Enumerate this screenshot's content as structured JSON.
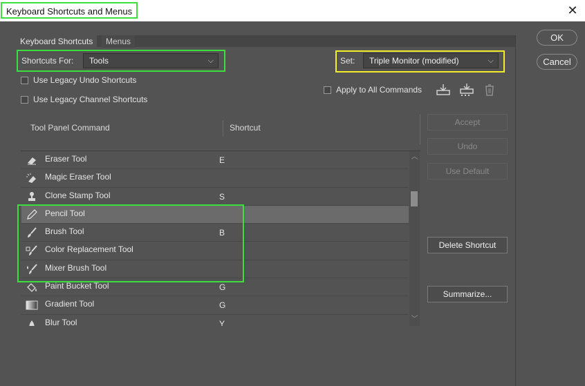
{
  "window": {
    "title": "Keyboard Shortcuts and Menus"
  },
  "tabs": [
    {
      "label": "Keyboard Shortcuts"
    },
    {
      "label": "Menus"
    }
  ],
  "shortcuts_for": {
    "label": "Shortcuts For:",
    "value": "Tools"
  },
  "set": {
    "label": "Set:",
    "value": "Triple Monitor (modified)"
  },
  "checkboxes": {
    "legacy_undo": {
      "label": "Use Legacy Undo Shortcuts",
      "checked": false
    },
    "legacy_channel": {
      "label": "Use Legacy Channel Shortcuts",
      "checked": false
    },
    "apply_all": {
      "label": "Apply to All Commands",
      "checked": false
    }
  },
  "columns": {
    "command": "Tool Panel Command",
    "shortcut": "Shortcut"
  },
  "rows": [
    {
      "icon": "eraser-icon",
      "name": "Eraser Tool",
      "shortcut": "E"
    },
    {
      "icon": "magic-eraser-icon",
      "name": "Magic Eraser Tool",
      "shortcut": ""
    },
    {
      "icon": "clone-stamp-icon",
      "name": "Clone Stamp Tool",
      "shortcut": "S"
    },
    {
      "icon": "pencil-icon",
      "name": "Pencil Tool",
      "shortcut": "",
      "selected": true
    },
    {
      "icon": "brush-icon",
      "name": "Brush Tool",
      "shortcut": "B"
    },
    {
      "icon": "color-replacement-icon",
      "name": "Color Replacement Tool",
      "shortcut": ""
    },
    {
      "icon": "mixer-brush-icon",
      "name": "Mixer Brush Tool",
      "shortcut": ""
    },
    {
      "icon": "paint-bucket-icon",
      "name": "Paint Bucket Tool",
      "shortcut": "G"
    },
    {
      "icon": "gradient-icon",
      "name": "Gradient Tool",
      "shortcut": "G"
    },
    {
      "icon": "blur-icon",
      "name": "Blur Tool",
      "shortcut": "Y"
    }
  ],
  "side_buttons": {
    "accept": "Accept",
    "undo": "Undo",
    "use_default": "Use Default",
    "delete_shortcut": "Delete Shortcut",
    "summarize": "Summarize..."
  },
  "dialog_buttons": {
    "ok": "OK",
    "cancel": "Cancel"
  },
  "colors": {
    "highlight_green": "#3ce03c",
    "highlight_yellow": "#f2ef28",
    "background": "#535353"
  }
}
